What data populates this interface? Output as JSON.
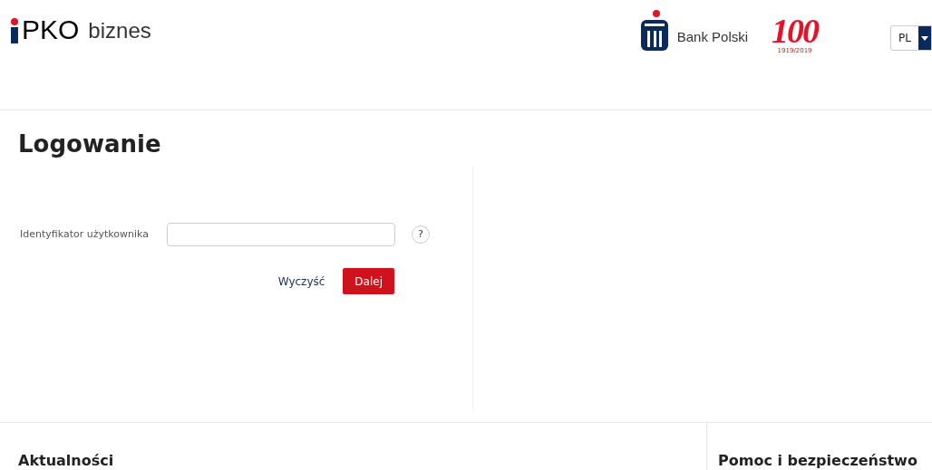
{
  "header": {
    "logo": {
      "brand": "PKO",
      "product": "biznes"
    },
    "bank_logo": {
      "text": "Bank Polski"
    },
    "jubilee_logo": {
      "number": "100",
      "years": "1919/2019"
    },
    "language": {
      "value": "PL"
    }
  },
  "login": {
    "title": "Logowanie",
    "field": {
      "label": "Identyfikator użytkownika",
      "help": "?"
    },
    "buttons": [
      {
        "label": "Wyczyść",
        "kind": "link"
      },
      {
        "label": "Dalej",
        "kind": "primary"
      }
    ]
  },
  "footer": {
    "sections": [
      {
        "title": "Aktualności"
      },
      {
        "title": "Pomoc i bezpieczeństwo"
      }
    ]
  }
}
